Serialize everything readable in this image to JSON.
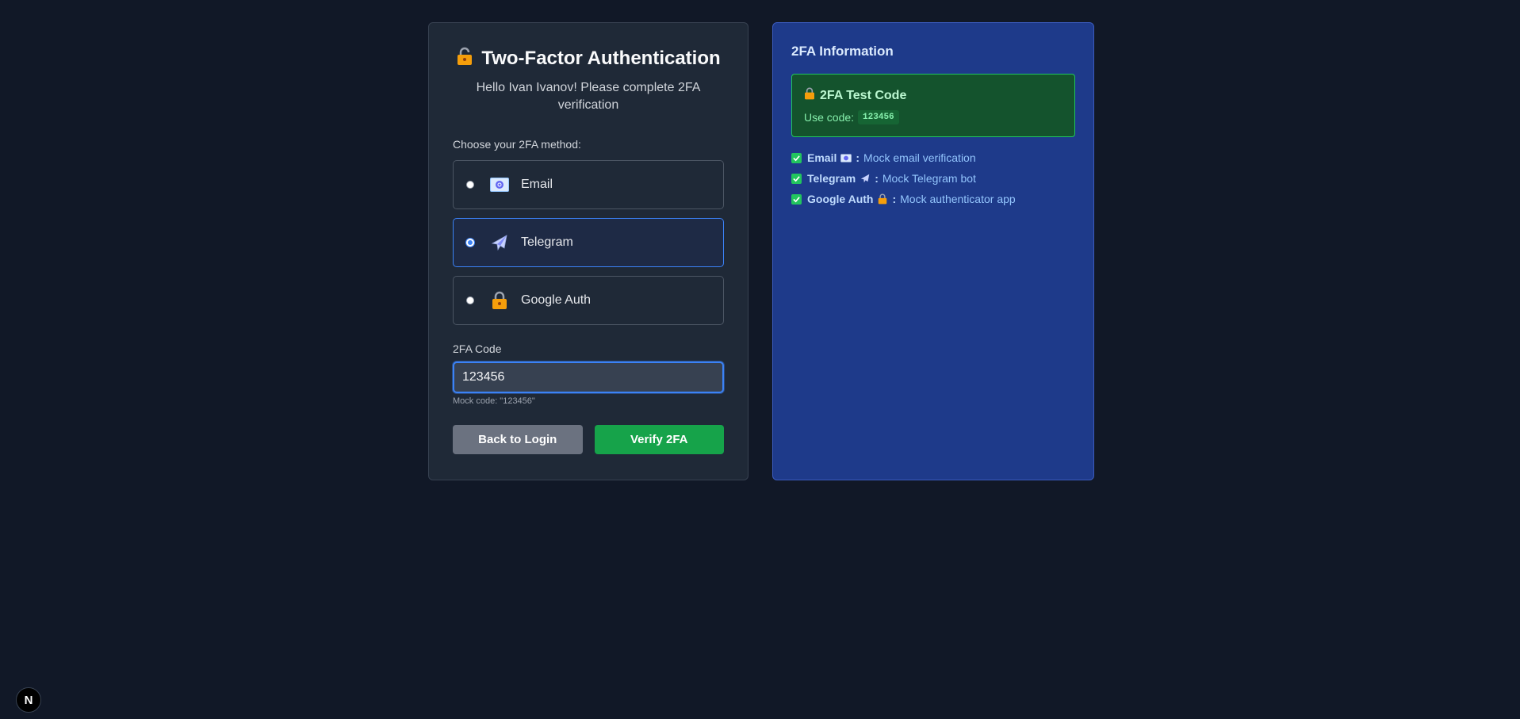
{
  "auth": {
    "title": "Two-Factor Authentication",
    "subtitle": "Hello Ivan Ivanov! Please complete 2FA verification",
    "method_prompt": "Choose your 2FA method:",
    "methods": [
      {
        "label": "Email",
        "icon": "email-icon",
        "selected": false
      },
      {
        "label": "Telegram",
        "icon": "airplane-icon",
        "selected": true
      },
      {
        "label": "Google Auth",
        "icon": "lock-icon",
        "selected": false
      }
    ],
    "code_label": "2FA Code",
    "code_value": "123456",
    "code_hint": "Mock code: \"123456\"",
    "back_button": "Back to Login",
    "verify_button": "Verify 2FA"
  },
  "info": {
    "title": "2FA Information",
    "test_box": {
      "title": "2FA Test Code",
      "use_label": "Use code:",
      "code": "123456"
    },
    "features": [
      {
        "name": "Email",
        "icon": "email-icon",
        "desc": "Mock email verification"
      },
      {
        "name": "Telegram",
        "icon": "airplane-icon",
        "desc": "Mock Telegram bot"
      },
      {
        "name": "Google Auth",
        "icon": "lock-icon",
        "desc": "Mock authenticator app"
      }
    ],
    "separator": ":"
  },
  "badge": {
    "label": "N"
  },
  "colors": {
    "background": "#111827",
    "card": "#1f2937",
    "info_panel": "#1e3a8a",
    "accent_blue": "#3b82f6",
    "success_green": "#16a34a"
  }
}
